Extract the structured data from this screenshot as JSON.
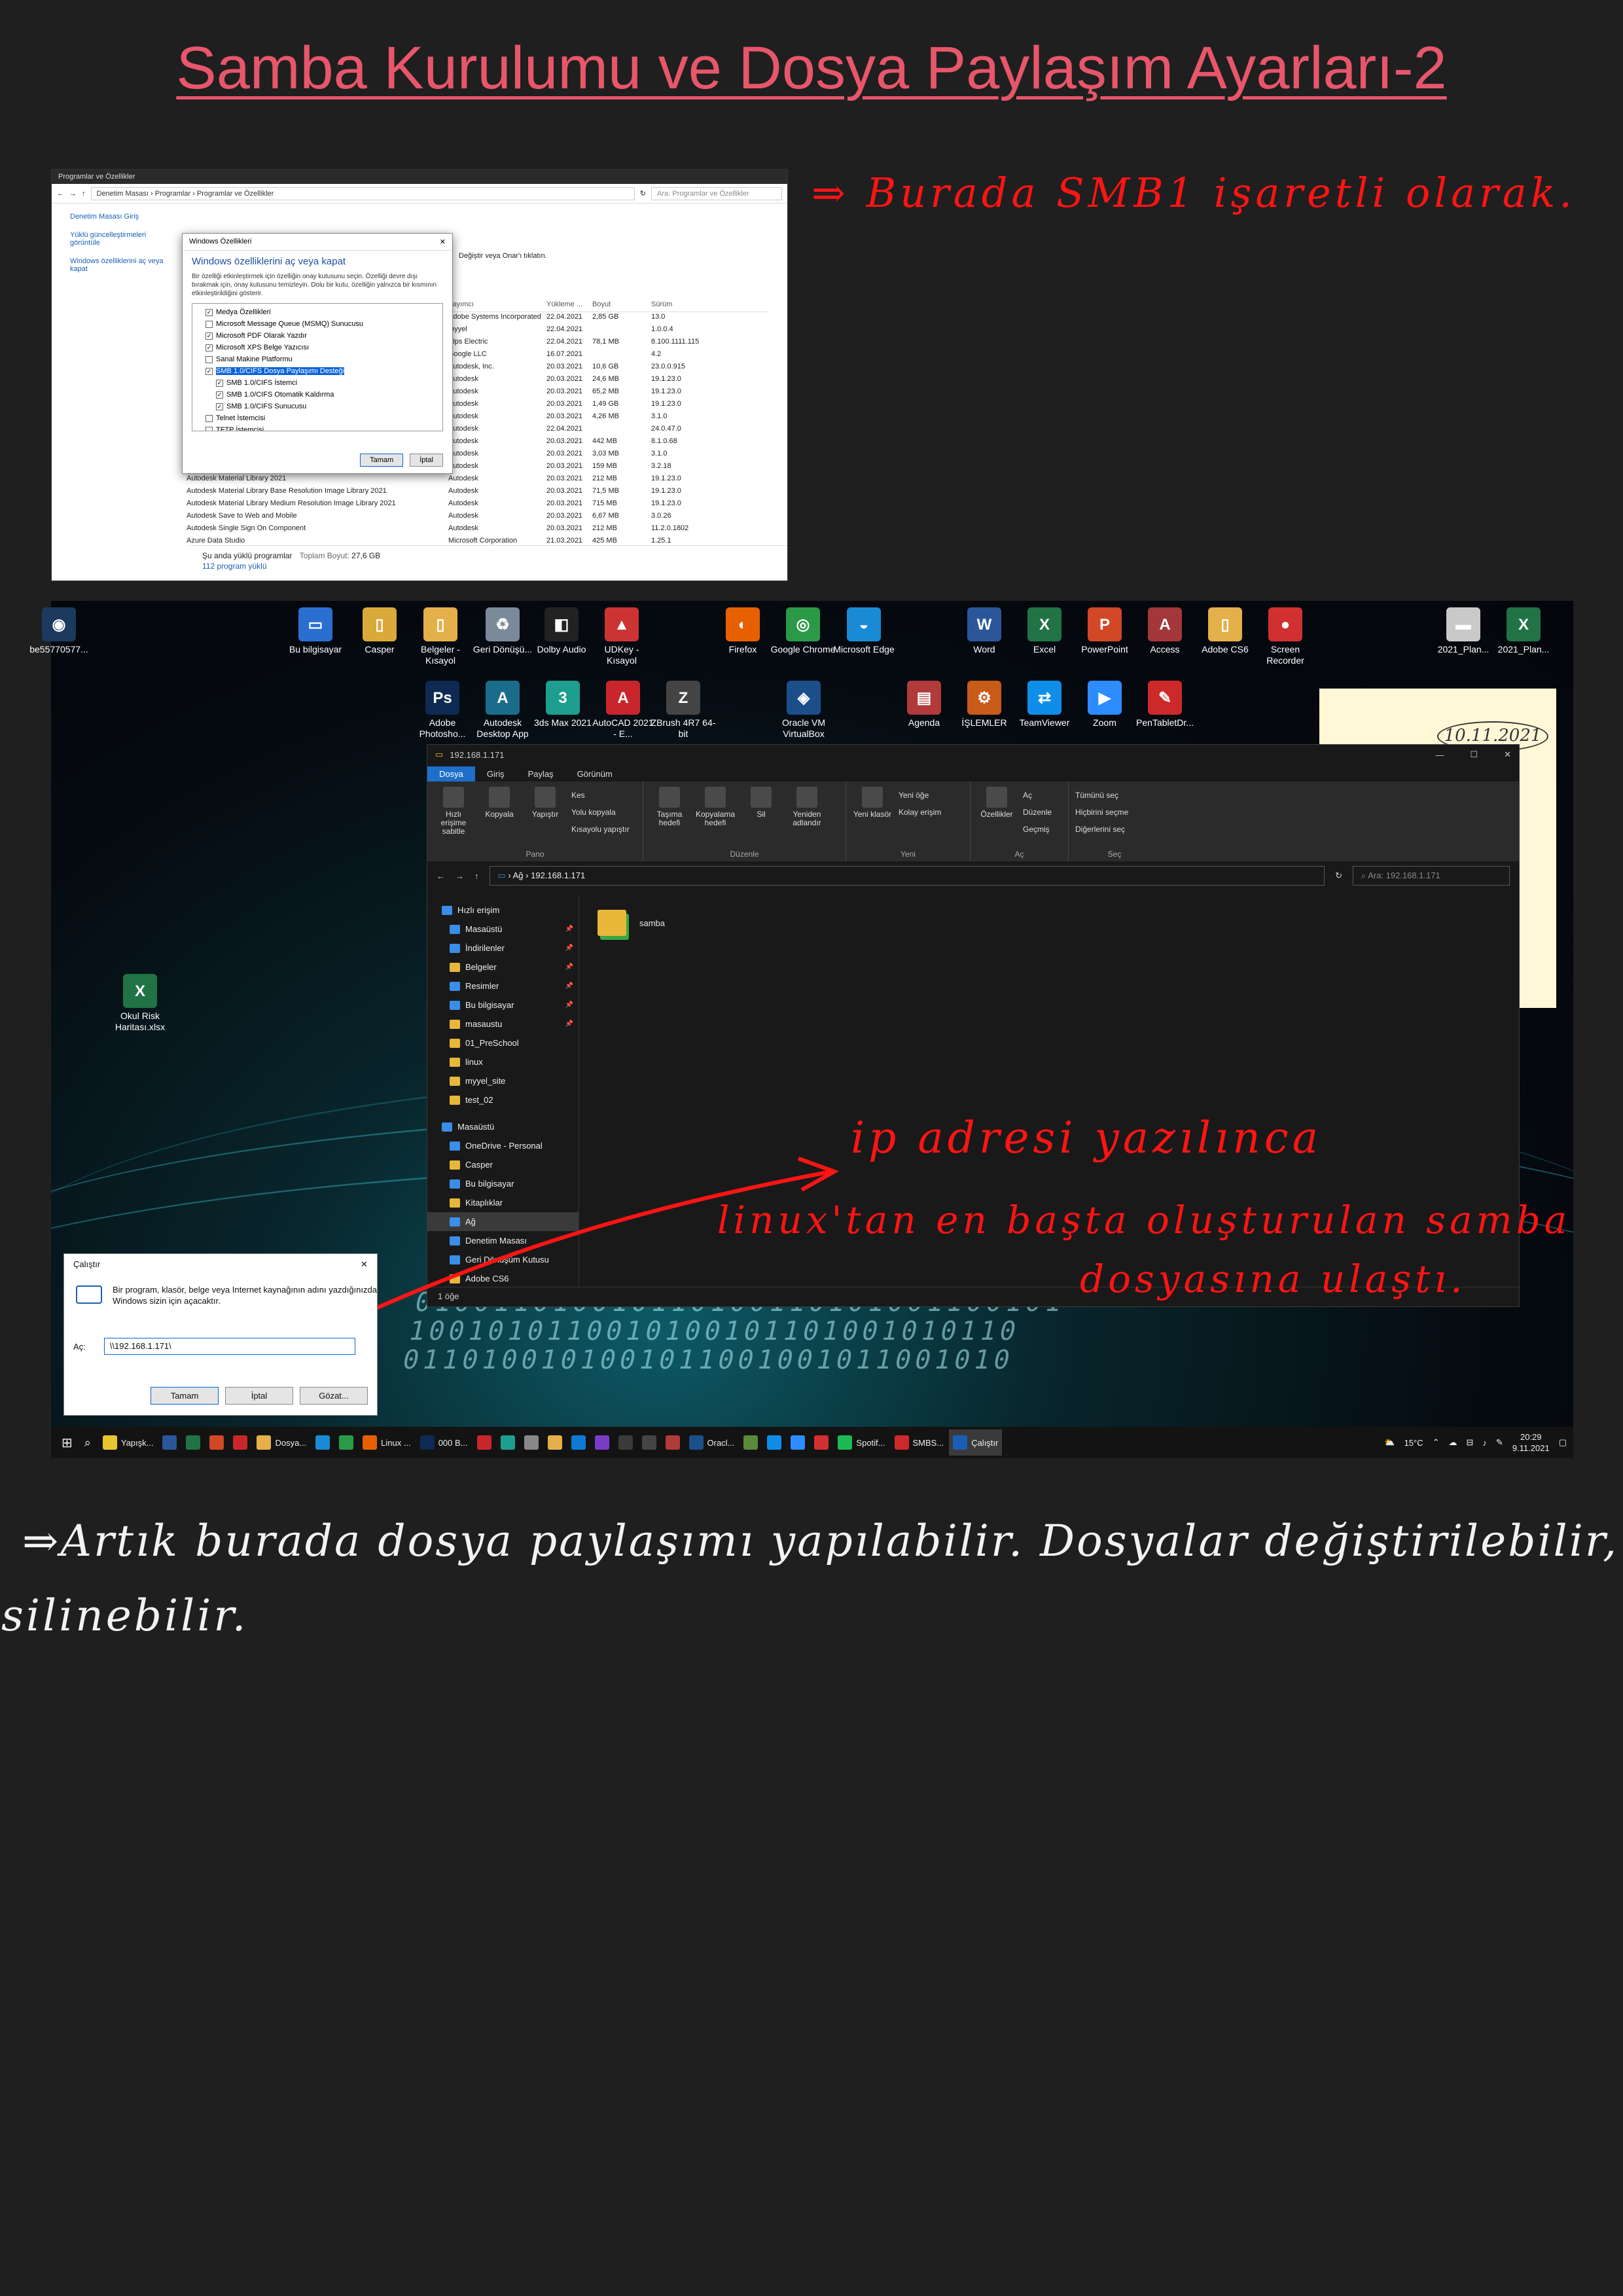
{
  "title": "Samba Kurulumu ve Dosya Paylaşım Ayarları-2",
  "annotations": {
    "smb1_note": "⇒ Burada SMB1 işaretli olarak.",
    "ip_note_line1": "ip adresi yazılınca",
    "ip_note_line2": "linux'tan en başta oluşturulan samba",
    "ip_note_line3": "dosyasına ulaştı.",
    "bottom_note_line1": "⇒Artık burada dosya paylaşımı yapılabilir. Dosyalar değiştirilebilir,",
    "bottom_note_line2": "silinebilir.",
    "sticky_date": "10.11.2021"
  },
  "programs_window": {
    "title": "Programlar ve Özellikler",
    "breadcrumb": "Denetim Masası  ›  Programlar  ›  Programlar ve Özellikler",
    "search_placeholder": "Ara: Programlar ve Özellikler",
    "side_links": [
      "Denetim Masası Giriş",
      "Yüklü güncelleştirmeleri görüntüle",
      "Windows özelliklerini aç veya kapat"
    ],
    "hint": "Değiştir veya Onar'ı tıklatın.",
    "columns": [
      "Yayımcı",
      "Yükleme ...",
      "Boyut",
      "Sürüm"
    ],
    "rows": [
      [
        "",
        "Adobe Systems Incorporated",
        "22.04.2021",
        "2,85 GB",
        "13.0"
      ],
      [
        "",
        "myyel",
        "22.04.2021",
        "",
        "1.0.0.4"
      ],
      [
        "",
        "Alps Electric",
        "22.04.2021",
        "78,1 MB",
        "8.100.1111.115"
      ],
      [
        "",
        "Google LLC",
        "16.07.2021",
        "",
        "4.2"
      ],
      [
        "",
        "Autodesk, Inc.",
        "20.03.2021",
        "10,6 GB",
        "23.0.0.915"
      ],
      [
        "",
        "Autodesk",
        "20.03.2021",
        "24,6 MB",
        "19.1.23.0"
      ],
      [
        "",
        "Autodesk",
        "20.03.2021",
        "65,2 MB",
        "19.1.23.0"
      ],
      [
        "",
        "Autodesk",
        "20.03.2021",
        "1,49 GB",
        "19.1.23.0"
      ],
      [
        "",
        "Autodesk",
        "20.03.2021",
        "4,26 MB",
        "3.1.0"
      ],
      [
        "",
        "Autodesk",
        "22.04.2021",
        "",
        "24.0.47.0"
      ],
      [
        "",
        "Autodesk",
        "20.03.2021",
        "442 MB",
        "8.1.0.68"
      ],
      [
        "",
        "Autodesk",
        "20.03.2021",
        "3,03 MB",
        "3.1.0"
      ],
      [
        "",
        "Autodesk",
        "20.03.2021",
        "159 MB",
        "3.2.18"
      ],
      [
        "Autodesk Material Library 2021",
        "Autodesk",
        "20.03.2021",
        "212 MB",
        "19.1.23.0"
      ],
      [
        "Autodesk Material Library Base Resolution Image Library 2021",
        "Autodesk",
        "20.03.2021",
        "71,5 MB",
        "19.1.23.0"
      ],
      [
        "Autodesk Material Library Medium Resolution Image Library 2021",
        "Autodesk",
        "20.03.2021",
        "715 MB",
        "19.1.23.0"
      ],
      [
        "Autodesk Save to Web and Mobile",
        "Autodesk",
        "20.03.2021",
        "6,67 MB",
        "3.0.26"
      ],
      [
        "Autodesk Single Sign On Component",
        "Autodesk",
        "20.03.2021",
        "212 MB",
        "11.2.0.1802"
      ],
      [
        "Azure Data Studio",
        "Microsoft Corporation",
        "21.03.2021",
        "425 MB",
        "1.25.1"
      ]
    ],
    "footer_main": "Şu anda yüklü programlar",
    "footer_size_label": "Toplam Boyut:",
    "footer_size": "27,6 GB",
    "footer_count": "112 program yüklü"
  },
  "features_dialog": {
    "title": "Windows Özellikleri",
    "heading": "Windows özelliklerini aç veya kapat",
    "description": "Bir özelliği etkinleştirmek için özelliğin onay kutusunu seçin. Özelliği devre dışı bırakmak için, onay kutusunu temizleyin. Dolu bir kutu, özelliğin yalnızca bir kısmının etkinleştirildiğini gösterir.",
    "items": [
      {
        "label": "Medya Özellikleri",
        "checked": "✓",
        "indent": 0
      },
      {
        "label": "Microsoft Message Queue (MSMQ) Sunucusu",
        "checked": "",
        "indent": 0
      },
      {
        "label": "Microsoft PDF Olarak Yazdır",
        "checked": "✓",
        "indent": 0
      },
      {
        "label": "Microsoft XPS Belge Yazıcısı",
        "checked": "✓",
        "indent": 0
      },
      {
        "label": "Sanal Makine Platformu",
        "checked": "",
        "indent": 0
      },
      {
        "label": "SMB 1.0/CIFS Dosya Paylaşımı Desteği",
        "checked": "✓",
        "indent": 0,
        "selected": true
      },
      {
        "label": "SMB 1.0/CIFS İstemci",
        "checked": "✓",
        "indent": 1
      },
      {
        "label": "SMB 1.0/CIFS Otomatik Kaldırma",
        "checked": "✓",
        "indent": 1
      },
      {
        "label": "SMB 1.0/CIFS Sunucusu",
        "checked": "✓",
        "indent": 1
      },
      {
        "label": "Telnet İstemcisi",
        "checked": "",
        "indent": 0
      },
      {
        "label": "TFTP İstemcisi",
        "checked": "",
        "indent": 0
      }
    ],
    "ok": "Tamam",
    "cancel": "İptal"
  },
  "desktop_icons": [
    {
      "label": "be55770577...",
      "color": "#1b3a5e",
      "glyph": "◉"
    },
    {
      "label": "Bu bilgisayar",
      "color": "#2a6fd0",
      "glyph": "▭"
    },
    {
      "label": "Casper",
      "color": "#d9a93a",
      "glyph": "▯"
    },
    {
      "label": "Belgeler - Kısayol",
      "color": "#e3b04a",
      "glyph": "▯"
    },
    {
      "label": "Geri Dönüşü...",
      "color": "#7a8a99",
      "glyph": "♻"
    },
    {
      "label": "Dolby Audio",
      "color": "#222",
      "glyph": "◧"
    },
    {
      "label": "UDKey - Kısayol",
      "color": "#cc3333",
      "glyph": "▲"
    },
    {
      "label": "Firefox",
      "color": "#e66000",
      "glyph": "◐"
    },
    {
      "label": "Google Chrome",
      "color": "#2b9a48",
      "glyph": "◎"
    },
    {
      "label": "Microsoft Edge",
      "color": "#1a8ad4",
      "glyph": "◒"
    },
    {
      "label": "Word",
      "color": "#2b579a",
      "glyph": "W"
    },
    {
      "label": "Excel",
      "color": "#217346",
      "glyph": "X"
    },
    {
      "label": "PowerPoint",
      "color": "#d24726",
      "glyph": "P"
    },
    {
      "label": "Access",
      "color": "#a4373a",
      "glyph": "A"
    },
    {
      "label": "Adobe CS6",
      "color": "#e3b04a",
      "glyph": "▯"
    },
    {
      "label": "Screen Recorder",
      "color": "#d03030",
      "glyph": "●"
    },
    {
      "label": "2021_Plan...",
      "color": "#c9c9c9",
      "glyph": "▬"
    },
    {
      "label": "2021_Plan...",
      "color": "#217346",
      "glyph": "X"
    },
    {
      "label": "Adobe Photosho...",
      "color": "#0e2a52",
      "glyph": "Ps"
    },
    {
      "label": "Autodesk Desktop App",
      "color": "#1a6d8a",
      "glyph": "A"
    },
    {
      "label": "3ds Max 2021",
      "color": "#1e9e8f",
      "glyph": "3"
    },
    {
      "label": "AutoCAD 2021 - E...",
      "color": "#c8262b",
      "glyph": "A"
    },
    {
      "label": "ZBrush 4R7 64-bit",
      "color": "#444",
      "glyph": "Z"
    },
    {
      "label": "Oracle VM VirtualBox",
      "color": "#1c4e8a",
      "glyph": "◈"
    },
    {
      "label": "Agenda",
      "color": "#b13a3a",
      "glyph": "▤"
    },
    {
      "label": "İŞLEMLER",
      "color": "#c85a1a",
      "glyph": "⚙"
    },
    {
      "label": "TeamViewer",
      "color": "#0e8ee9",
      "glyph": "⇄"
    },
    {
      "label": "Zoom",
      "color": "#2d8cff",
      "glyph": "▶"
    },
    {
      "label": "PenTabletDr...",
      "color": "#cc2a2a",
      "glyph": "✎"
    },
    {
      "label": "Okul Risk Haritası.xlsx",
      "color": "#217346",
      "glyph": "X"
    }
  ],
  "explorer": {
    "title": "192.168.1.171",
    "tabs": [
      "Dosya",
      "Giriş",
      "Paylaş",
      "Görünüm"
    ],
    "ribbon": {
      "pin": "Hızlı erişime sabitle",
      "copy": "Kopyala",
      "paste": "Yapıştır",
      "cut": "Kes",
      "copy_path": "Yolu kopyala",
      "paste_shortcut": "Kısayolu yapıştır",
      "group_pano": "Pano",
      "move_to": "Taşıma hedefi",
      "copy_to": "Kopyalama hedefi",
      "delete": "Sil",
      "rename": "Yeniden adlandır",
      "group_organize": "Düzenle",
      "new_folder": "Yeni klasör",
      "new_item": "Yeni öğe",
      "easy_access": "Kolay erişim",
      "group_new": "Yeni",
      "properties": "Özellikler",
      "open": "Aç",
      "edit": "Düzenle",
      "history": "Geçmiş",
      "group_open": "Aç",
      "select_all": "Tümünü seç",
      "select_none": "Hiçbirini seçme",
      "invert": "Diğerlerini seç",
      "group_select": "Seç"
    },
    "path_prefix": "Ağ",
    "path": "192.168.1.171",
    "search_placeholder": "Ara: 192.168.1.171",
    "sidebar": [
      {
        "label": "Hızlı erişim",
        "top": true,
        "blue": true
      },
      {
        "label": "Masaüstü",
        "blue": true,
        "pin": "📌"
      },
      {
        "label": "İndirilenler",
        "blue": true,
        "pin": "📌"
      },
      {
        "label": "Belgeler",
        "pin": "📌"
      },
      {
        "label": "Resimler",
        "blue": true,
        "pin": "📌"
      },
      {
        "label": "Bu bilgisayar",
        "blue": true,
        "pin": "📌"
      },
      {
        "label": "masaustu",
        "pin": "📌"
      },
      {
        "label": "01_PreSchool"
      },
      {
        "label": "linux"
      },
      {
        "label": "myyel_site"
      },
      {
        "label": "test_02"
      },
      {
        "label": "",
        "spacer": true
      },
      {
        "label": "Masaüstü",
        "top": true,
        "blue": true
      },
      {
        "label": "OneDrive - Personal",
        "blue": true
      },
      {
        "label": "Casper"
      },
      {
        "label": "Bu bilgisayar",
        "blue": true
      },
      {
        "label": "Kitaplıklar"
      },
      {
        "label": "Ağ",
        "blue": true,
        "selected": true
      },
      {
        "label": "Denetim Masası",
        "blue": true
      },
      {
        "label": "Geri Dönüşüm Kutusu",
        "blue": true
      },
      {
        "label": "Adobe CS6"
      }
    ],
    "folder": "samba",
    "status": "1 öğe"
  },
  "run_dialog": {
    "title": "Çalıştır",
    "description": "Bir program, klasör, belge veya Internet kaynağının adını yazdığınızda Windows sizin için açacaktır.",
    "open_label": "Aç:",
    "value": "\\\\192.168.1.171\\",
    "ok": "Tamam",
    "cancel": "İptal",
    "browse": "Gözat..."
  },
  "taskbar": {
    "items": [
      {
        "label": "Yapışk...",
        "color": "#e8c530"
      },
      {
        "label": "",
        "color": "#2b579a"
      },
      {
        "label": "",
        "color": "#217346"
      },
      {
        "label": "",
        "color": "#d24726"
      },
      {
        "label": "",
        "color": "#c8262b"
      },
      {
        "label": "Dosya...",
        "color": "#e3b04a"
      },
      {
        "label": "",
        "color": "#1a8ad4"
      },
      {
        "label": "",
        "color": "#2b9a48"
      },
      {
        "label": "Linux ...",
        "color": "#e66000"
      },
      {
        "label": "000 B...",
        "color": "#0e2a52"
      },
      {
        "label": "",
        "color": "#c8262b"
      },
      {
        "label": "",
        "color": "#1e9e8f"
      },
      {
        "label": "",
        "color": "#888"
      },
      {
        "label": "",
        "color": "#e3b04a"
      },
      {
        "label": "",
        "color": "#0e7ad4"
      },
      {
        "label": "",
        "color": "#7a3cc8"
      },
      {
        "label": "",
        "color": "#3a3a3a"
      },
      {
        "label": "",
        "color": "#444"
      },
      {
        "label": "",
        "color": "#b13a3a"
      },
      {
        "label": "Oracl...",
        "color": "#1c4e8a"
      },
      {
        "label": "",
        "color": "#5a8a3a"
      },
      {
        "label": "",
        "color": "#0e8ee9"
      },
      {
        "label": "",
        "color": "#2d8cff"
      },
      {
        "label": "",
        "color": "#d03030"
      },
      {
        "label": "Spotif...",
        "color": "#1db954"
      },
      {
        "label": "SMBS...",
        "color": "#cc2a2a"
      },
      {
        "label": "Çalıştır",
        "color": "#1a5fb4"
      }
    ],
    "temperature": "15°C",
    "time": "20:29",
    "date": "9.11.2021"
  }
}
